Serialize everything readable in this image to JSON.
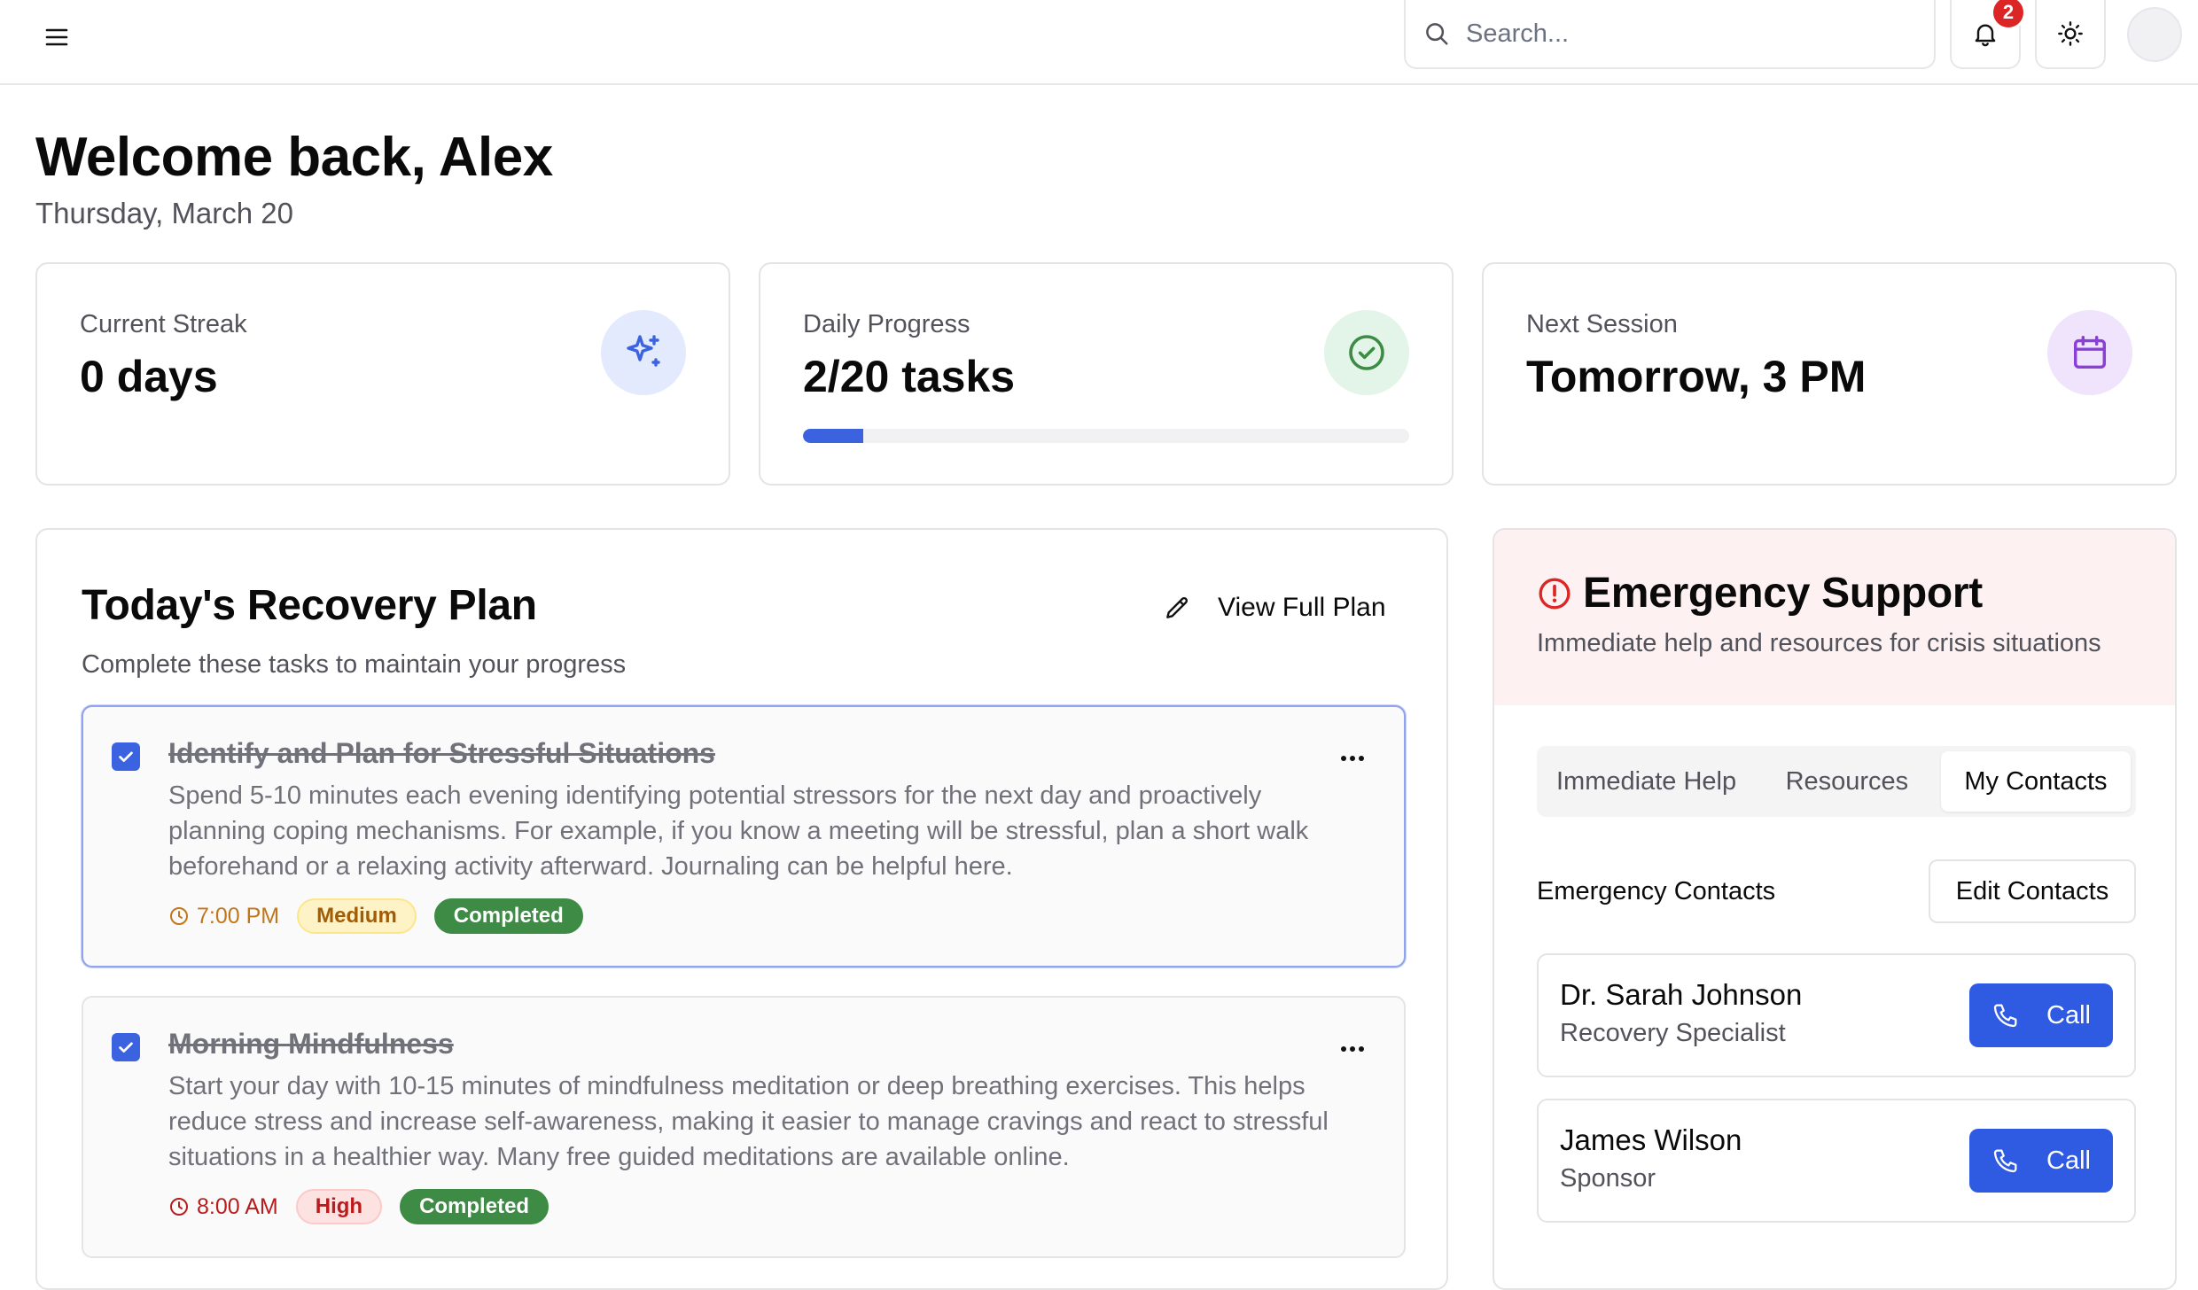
{
  "header": {
    "search_placeholder": "Search...",
    "notification_count": "2"
  },
  "greeting": {
    "title": "Welcome back, Alex",
    "date": "Thursday, March 20"
  },
  "stats": [
    {
      "label": "Current Streak",
      "value": "0 days",
      "icon": "sparkles-icon",
      "icon_bg": "#e3eafd",
      "icon_color": "#3b63e0"
    },
    {
      "label": "Daily Progress",
      "value": "2/20 tasks",
      "icon": "check-circle-icon",
      "icon_bg": "#e3f5e8",
      "icon_color": "#3d8b45",
      "progress": 0.1
    },
    {
      "label": "Next Session",
      "value": "Tomorrow, 3 PM",
      "icon": "calendar-icon",
      "icon_bg": "#efe4fb",
      "icon_color": "#8b3fd9"
    }
  ],
  "plan": {
    "title": "Today's Recovery Plan",
    "subtitle": "Complete these tasks to maintain your progress",
    "view_full_label": "View Full Plan",
    "tasks": [
      {
        "title": "Identify and Plan for Stressful Situations",
        "description": "Spend 5-10 minutes each evening identifying potential stressors for the next day and proactively planning coping mechanisms. For example, if you know a meeting will be stressful, plan a short walk beforehand or a relaxing activity afterward. Journaling can be helpful here.",
        "time": "7:00 PM",
        "priority": "Medium",
        "status": "Completed",
        "checked": true
      },
      {
        "title": "Morning Mindfulness",
        "description": "Start your day with 10-15 minutes of mindfulness meditation or deep breathing exercises. This helps reduce stress and increase self-awareness, making it easier to manage cravings and react to stressful situations in a healthier way. Many free guided meditations are available online.",
        "time": "8:00 AM",
        "priority": "High",
        "status": "Completed",
        "checked": true
      }
    ]
  },
  "emergency": {
    "title": "Emergency Support",
    "subtitle": "Immediate help and resources for crisis situations",
    "tabs": [
      "Immediate Help",
      "Resources",
      "My Contacts"
    ],
    "selected_tab": "My Contacts",
    "contacts_label": "Emergency Contacts",
    "edit_label": "Edit Contacts",
    "contacts": [
      {
        "name": "Dr. Sarah Johnson",
        "role": "Recovery Specialist",
        "call_label": "Call"
      },
      {
        "name": "James Wilson",
        "role": "Sponsor",
        "call_label": "Call"
      }
    ]
  },
  "colors": {
    "accent": "#3b63e0",
    "success": "#3d8b45",
    "danger": "#dc2626",
    "medium_time": "#c2761a",
    "high_time": "#b91c1c"
  }
}
